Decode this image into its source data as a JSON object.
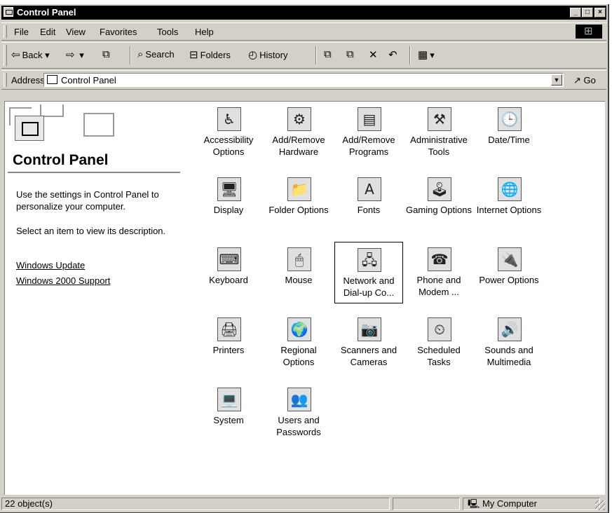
{
  "window": {
    "title": "Control Panel"
  },
  "menubar": {
    "items": [
      "File",
      "Edit",
      "View",
      "Favorites",
      "Tools",
      "Help"
    ]
  },
  "toolbar": {
    "back": "Back",
    "search": "Search",
    "folders": "Folders",
    "history": "History"
  },
  "address": {
    "label": "Address",
    "value": "Control Panel",
    "go": "Go"
  },
  "left_panel": {
    "title": "Control Panel",
    "description1": "Use the settings in Control Panel to personalize your computer.",
    "description2": "Select an item to view its description.",
    "links": [
      "Windows Update",
      "Windows 2000 Support"
    ]
  },
  "items": [
    {
      "label": "Accessibility Options",
      "icon": "accessibility-icon"
    },
    {
      "label": "Add/Remove Hardware",
      "icon": "add-remove-hardware-icon"
    },
    {
      "label": "Add/Remove Programs",
      "icon": "add-remove-programs-icon"
    },
    {
      "label": "Administrative Tools",
      "icon": "administrative-tools-icon"
    },
    {
      "label": "Date/Time",
      "icon": "date-time-icon"
    },
    {
      "label": "Display",
      "icon": "display-icon"
    },
    {
      "label": "Folder Options",
      "icon": "folder-options-icon"
    },
    {
      "label": "Fonts",
      "icon": "fonts-icon"
    },
    {
      "label": "Gaming Options",
      "icon": "gaming-options-icon"
    },
    {
      "label": "Internet Options",
      "icon": "internet-options-icon"
    },
    {
      "label": "Keyboard",
      "icon": "keyboard-icon"
    },
    {
      "label": "Mouse",
      "icon": "mouse-icon"
    },
    {
      "label": "Network and Dial-up Co...",
      "icon": "network-icon",
      "selected": true
    },
    {
      "label": "Phone and Modem ...",
      "icon": "phone-modem-icon"
    },
    {
      "label": "Power Options",
      "icon": "power-options-icon"
    },
    {
      "label": "Printers",
      "icon": "printers-icon"
    },
    {
      "label": "Regional Options",
      "icon": "regional-options-icon"
    },
    {
      "label": "Scanners and Cameras",
      "icon": "scanners-cameras-icon"
    },
    {
      "label": "Scheduled Tasks",
      "icon": "scheduled-tasks-icon"
    },
    {
      "label": "Sounds and Multimedia",
      "icon": "sounds-multimedia-icon"
    },
    {
      "label": "System",
      "icon": "system-icon"
    },
    {
      "label": "Users and Passwords",
      "icon": "users-passwords-icon"
    }
  ],
  "statusbar": {
    "count": "22 object(s)",
    "zone": "My Computer"
  }
}
